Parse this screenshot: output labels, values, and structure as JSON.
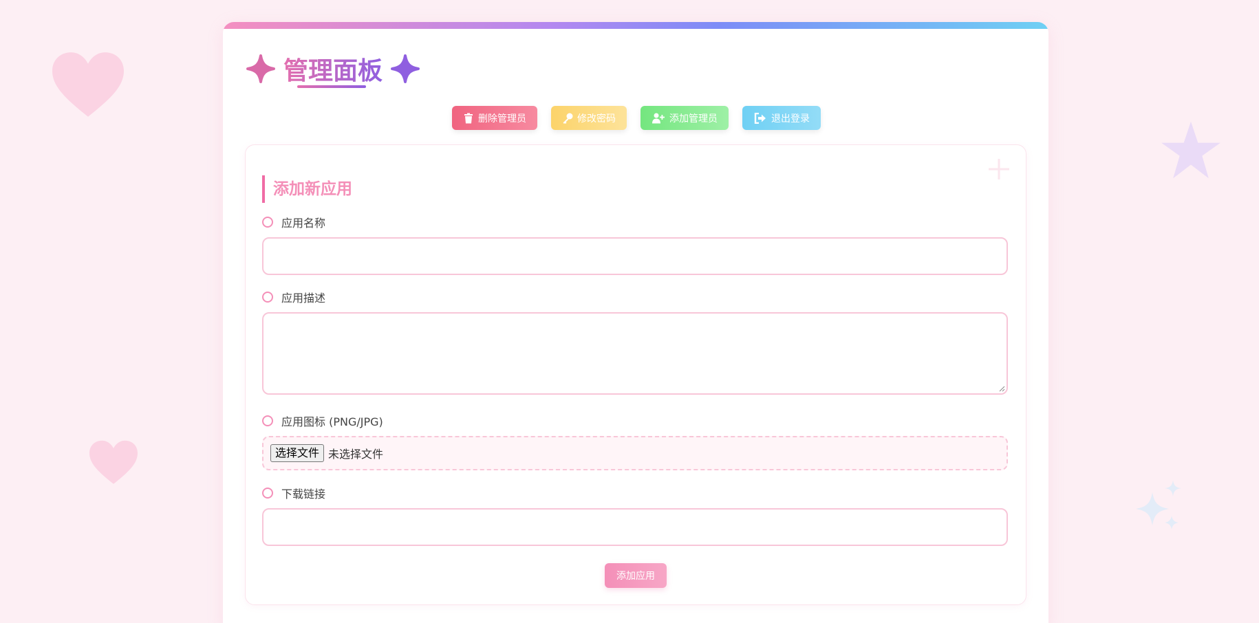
{
  "header": {
    "title": "管理面板"
  },
  "toolbar": {
    "delete_admin": "删除管理员",
    "change_password": "修改密码",
    "add_admin": "添加管理员",
    "logout": "退出登录"
  },
  "form": {
    "section_title": "添加新应用",
    "app_name_label": "应用名称",
    "app_name_value": "",
    "app_desc_label": "应用描述",
    "app_desc_value": "",
    "app_icon_label": "应用图标 (PNG/JPG)",
    "file_button": "选择文件",
    "file_status": "未选择文件",
    "download_label": "下载链接",
    "download_value": "",
    "submit": "添加应用"
  },
  "colors": {
    "accent_pink": "#f48fb8",
    "accent_purple": "#8f5fe0",
    "delete_red": "#f06480",
    "password_yellow": "#fcd36a",
    "add_green": "#74e67f",
    "logout_blue": "#6fd0f4"
  },
  "icons": {
    "title_left": "sparkle-icon",
    "title_right": "sparkle-icon",
    "delete": "trash-icon",
    "password": "key-icon",
    "add_admin": "user-plus-icon",
    "logout": "sign-out-icon"
  }
}
